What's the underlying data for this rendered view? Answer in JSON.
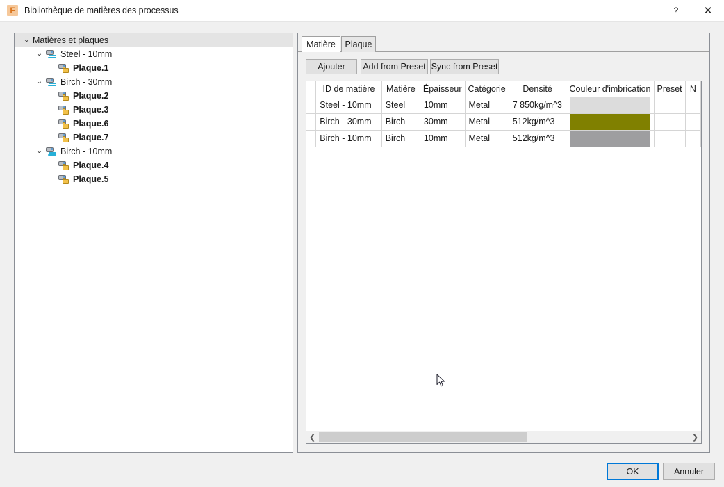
{
  "window": {
    "title": "Bibliothèque de matières des processus",
    "app_icon": "fusion-f-icon",
    "help_label": "?",
    "close_label": "✕"
  },
  "tree": {
    "root": {
      "label": "Matières et plaques",
      "expanded": true
    },
    "groups": [
      {
        "label": "Steel - 10mm",
        "expanded": true,
        "icon": "material-stack-icon",
        "children": [
          {
            "label": "Plaque.1",
            "icon": "plate-icon"
          }
        ]
      },
      {
        "label": "Birch - 30mm",
        "expanded": true,
        "icon": "material-stack-icon",
        "children": [
          {
            "label": "Plaque.2",
            "icon": "plate-icon"
          },
          {
            "label": "Plaque.3",
            "icon": "plate-icon"
          },
          {
            "label": "Plaque.6",
            "icon": "plate-icon"
          },
          {
            "label": "Plaque.7",
            "icon": "plate-icon"
          }
        ]
      },
      {
        "label": "Birch - 10mm",
        "expanded": true,
        "icon": "material-stack-icon",
        "children": [
          {
            "label": "Plaque.4",
            "icon": "plate-icon"
          },
          {
            "label": "Plaque.5",
            "icon": "plate-icon"
          }
        ]
      }
    ]
  },
  "panel": {
    "tabs": [
      {
        "label": "Matière",
        "active": true
      },
      {
        "label": "Plaque",
        "active": false
      }
    ],
    "toolbar": {
      "add_label": "Ajouter",
      "add_from_preset_label": "Add from Preset",
      "sync_from_preset_label": "Sync from Preset"
    },
    "table": {
      "columns": [
        "",
        "ID de matière",
        "Matière",
        "Épaisseur",
        "Catégorie",
        "Densité",
        "Couleur d'imbrication",
        "Preset",
        "N"
      ],
      "rows": [
        {
          "id": "Steel - 10mm",
          "matiere": "Steel",
          "epaisseur": "10mm",
          "categorie": "Metal",
          "densite": "7 850kg/m^3",
          "couleur": "#dcdcdc",
          "preset": "",
          "n": ""
        },
        {
          "id": "Birch - 30mm",
          "matiere": "Birch",
          "epaisseur": "30mm",
          "categorie": "Metal",
          "densite": "512kg/m^3",
          "couleur": "#808000",
          "preset": "",
          "n": ""
        },
        {
          "id": "Birch - 10mm",
          "matiere": "Birch",
          "epaisseur": "10mm",
          "categorie": "Metal",
          "densite": "512kg/m^3",
          "couleur": "#9e9ea0",
          "preset": "",
          "n": ""
        }
      ]
    },
    "hscrollbar": {
      "left_arrow": "❮",
      "right_arrow": "❯"
    }
  },
  "footer": {
    "ok_label": "OK",
    "cancel_label": "Annuler"
  },
  "theme": {
    "accent": "#0078d7",
    "window_bg": "#f0f0f0",
    "panel_border": "#8b8f96"
  }
}
